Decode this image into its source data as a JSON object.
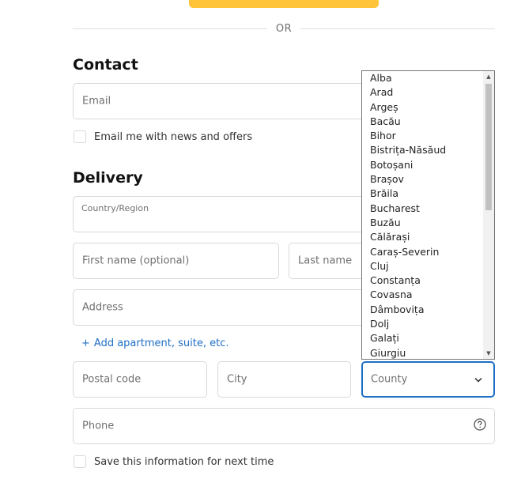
{
  "divider": {
    "text": "OR"
  },
  "contact": {
    "title": "Contact",
    "email_placeholder": "Email",
    "newsletter_label": "Email me with news and offers"
  },
  "delivery": {
    "title": "Delivery",
    "country_label": "Country/Region",
    "first_name_placeholder": "First name (optional)",
    "last_name_placeholder": "Last name",
    "address_placeholder": "Address",
    "add_apartment_label": "Add apartment, suite, etc.",
    "postal_code_placeholder": "Postal code",
    "city_placeholder": "City",
    "county_placeholder": "County",
    "phone_placeholder": "Phone",
    "save_info_label": "Save this information for next time"
  },
  "county_options": [
    "Alba",
    "Arad",
    "Argeș",
    "Bacău",
    "Bihor",
    "Bistrița-Năsăud",
    "Botoșani",
    "Brașov",
    "Brăila",
    "Bucharest",
    "Buzău",
    "Călărași",
    "Caraș-Severin",
    "Cluj",
    "Constanța",
    "Covasna",
    "Dâmbovița",
    "Dolj",
    "Galați",
    "Giurgiu"
  ],
  "icons": {
    "add": "plus-icon",
    "county_dropdown": "chevron-down-icon",
    "phone_help": "question-circle-icon"
  },
  "colors": {
    "accent": "#1f6fc5",
    "express_button": "#ffc439"
  }
}
